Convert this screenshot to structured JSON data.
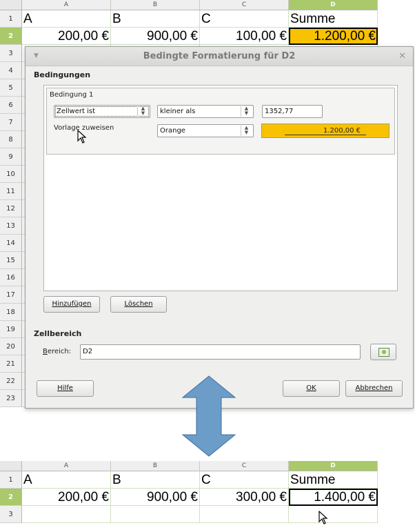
{
  "top_sheet": {
    "columns": [
      "A",
      "B",
      "C",
      "D"
    ],
    "rows": [
      "1",
      "2",
      "3",
      "4",
      "5",
      "6",
      "7",
      "8",
      "9",
      "10",
      "11",
      "12",
      "13",
      "14",
      "15",
      "16",
      "17",
      "18",
      "19",
      "20",
      "21",
      "22",
      "23"
    ],
    "row1": [
      "A",
      "B",
      "C",
      "Summe"
    ],
    "row2": [
      "200,00 €",
      "900,00 €",
      "100,00 €",
      "1.200,00 €"
    ]
  },
  "dialog": {
    "title": "Bedingte Formatierung für D2",
    "conditions_label": "Bedingungen",
    "condition1": {
      "title": "Bedingung 1",
      "type_value": "Zellwert ist",
      "operator_value": "kleiner als",
      "value": "1352,77",
      "style_label": "Vorlage zuweisen",
      "style_value": "Orange",
      "preview_text": "1.200,00 €"
    },
    "add_button": {
      "mnemonic": "H",
      "rest": "inzufügen"
    },
    "delete_button": {
      "mnemonic": "L",
      "rest": "öschen"
    },
    "cell_range_label": "Zellbereich",
    "range_label": {
      "mnemonic": "B",
      "rest": "ereich:"
    },
    "range_value": "D2",
    "help_button": {
      "mnemonic": "H",
      "rest": "ilfe"
    },
    "ok_button": {
      "mnemonic": "O",
      "rest": "K"
    },
    "cancel_button": {
      "mnemonic": "A",
      "rest": "bbrechen"
    }
  },
  "bottom_sheet": {
    "columns": [
      "A",
      "B",
      "C",
      "D"
    ],
    "rows": [
      "1",
      "2",
      "3"
    ],
    "row1": [
      "A",
      "B",
      "C",
      "Summe"
    ],
    "row2": [
      "200,00 €",
      "900,00 €",
      "300,00 €",
      "1.400,00 €"
    ]
  },
  "colors": {
    "highlight_orange": "#f8c200",
    "selected_header_green": "#a9c96a",
    "arrow_blue": "#6c9cc8"
  },
  "icons": [
    "menu-icon",
    "close-icon",
    "shrink-range-icon",
    "mouse-cursor-icon",
    "double-arrow-icon"
  ]
}
